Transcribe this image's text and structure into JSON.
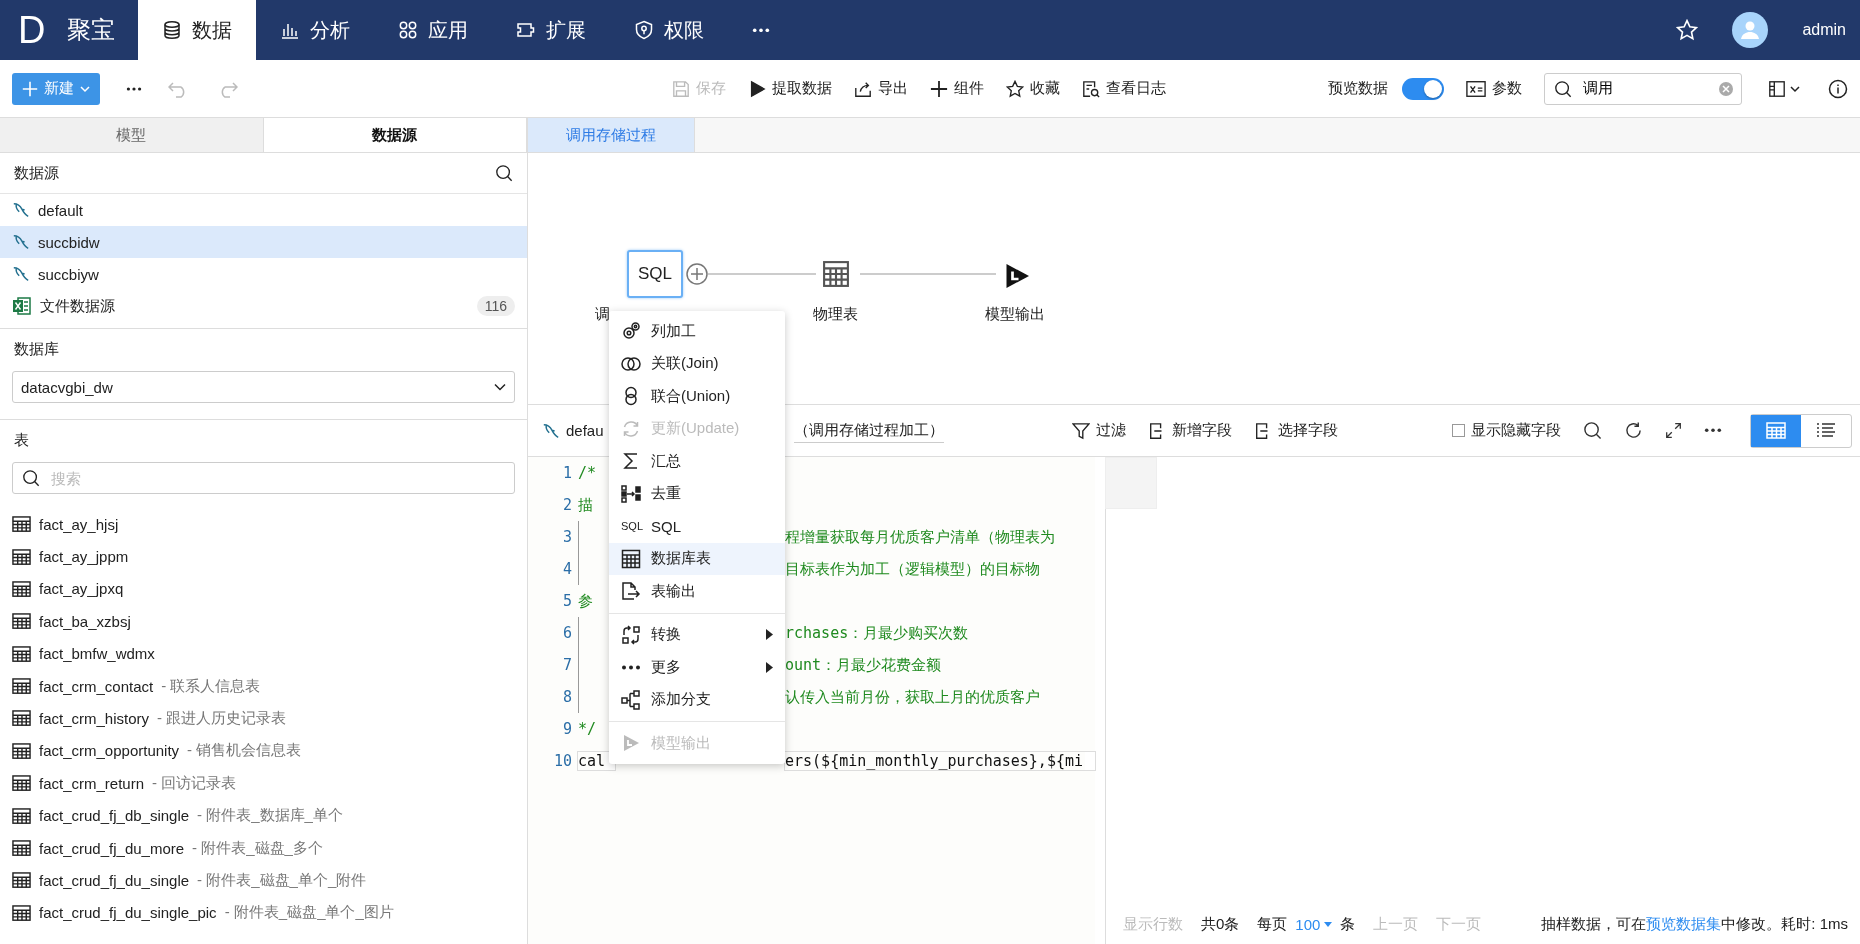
{
  "nav": {
    "logo_letter": "D",
    "brand": "聚宝",
    "tabs": [
      {
        "label": "数据",
        "selected": true
      },
      {
        "label": "分析",
        "selected": false
      },
      {
        "label": "应用",
        "selected": false
      },
      {
        "label": "扩展",
        "selected": false
      },
      {
        "label": "权限",
        "selected": false
      }
    ],
    "user": "admin"
  },
  "toolbar": {
    "new_button": "新建",
    "actions": [
      {
        "label": "保存",
        "disabled": true
      },
      {
        "label": "提取数据",
        "disabled": false
      },
      {
        "label": "导出",
        "disabled": false
      },
      {
        "label": "组件",
        "disabled": false
      },
      {
        "label": "收藏",
        "disabled": false
      },
      {
        "label": "查看日志",
        "disabled": false
      }
    ],
    "preview": {
      "label": "预览数据",
      "on": true
    },
    "params": "参数",
    "search": {
      "value": "调用"
    }
  },
  "left_tabs": [
    {
      "label": "模型",
      "selected": false
    },
    {
      "label": "数据源",
      "selected": true
    }
  ],
  "datasources": {
    "title": "数据源",
    "items": [
      {
        "name": "default",
        "kind": "db",
        "selected": false
      },
      {
        "name": "succbidw",
        "kind": "db",
        "selected": true
      },
      {
        "name": "succbiyw",
        "kind": "db",
        "selected": false
      },
      {
        "name": "文件数据源",
        "kind": "file",
        "count": "116",
        "selected": false
      }
    ]
  },
  "database": {
    "title": "数据库",
    "value": "datacvgbi_dw"
  },
  "tables": {
    "title": "表",
    "search_placeholder": "搜索",
    "items": [
      {
        "name": "fact_ay_hjsj"
      },
      {
        "name": "fact_ay_jppm"
      },
      {
        "name": "fact_ay_jpxq"
      },
      {
        "name": "fact_ba_xzbsj"
      },
      {
        "name": "fact_bmfw_wdmx"
      },
      {
        "name": "fact_crm_contact",
        "comment": "- 联系人信息表"
      },
      {
        "name": "fact_crm_history",
        "comment": "- 跟进人历史记录表"
      },
      {
        "name": "fact_crm_opportunity",
        "comment": "- 销售机会信息表"
      },
      {
        "name": "fact_crm_return",
        "comment": "- 回访记录表"
      },
      {
        "name": "fact_crud_fj_db_single",
        "comment": "- 附件表_数据库_单个"
      },
      {
        "name": "fact_crud_fj_du_more",
        "comment": "- 附件表_磁盘_多个"
      },
      {
        "name": "fact_crud_fj_du_single",
        "comment": "- 附件表_磁盘_单个_附件"
      },
      {
        "name": "fact_crud_fj_du_single_pic",
        "comment": "- 附件表_磁盘_单个_图片"
      }
    ]
  },
  "editor_tabs": [
    {
      "label": "调用存储过程",
      "selected": true
    }
  ],
  "flow": {
    "nodes": [
      {
        "kind": "sql",
        "text": "SQL",
        "label": "调",
        "selected": true
      },
      {
        "kind": "table",
        "label": "物理表",
        "selected": false
      },
      {
        "kind": "output",
        "label": "模型输出",
        "selected": false
      }
    ]
  },
  "editor_bar": {
    "source": "defau",
    "node_title": "（调用存储过程加工）",
    "actions": [
      "过滤",
      "新增字段",
      "选择字段"
    ],
    "show_hidden": {
      "label": "显示隐藏字段",
      "checked": false
    },
    "views": [
      {
        "kind": "grid",
        "selected": true
      },
      {
        "kind": "list",
        "selected": false
      }
    ]
  },
  "code": [
    {
      "number": "1",
      "kind": "comment",
      "guide": false,
      "left": "/*"
    },
    {
      "number": "2",
      "kind": "comment",
      "guide": false,
      "left": "描"
    },
    {
      "number": "3",
      "kind": "comment",
      "guide": true,
      "right": "程增量获取每月优质客户清单（物理表为"
    },
    {
      "number": "4",
      "kind": "comment",
      "guide": true,
      "right": "目标表作为加工（逻辑模型）的目标物"
    },
    {
      "number": "5",
      "kind": "comment",
      "guide": false,
      "left": "参"
    },
    {
      "number": "6",
      "kind": "comment",
      "guide": true,
      "right": "rchases：月最少购买次数"
    },
    {
      "number": "7",
      "kind": "comment",
      "guide": true,
      "right": "ount：月最少花费金额"
    },
    {
      "number": "8",
      "kind": "comment",
      "guide": true,
      "right": "认传入当前月份，获取上月的优质客户"
    },
    {
      "number": "9",
      "kind": "comment",
      "guide": false,
      "left": "*/"
    },
    {
      "number": "10",
      "kind": "code",
      "guide": false,
      "left": "cal",
      "right": "ers(${min_monthly_purchases},${mi"
    }
  ],
  "footer": {
    "rows_label": "显示行数",
    "total": "共0条",
    "per_page": "每页",
    "page_size": "100",
    "unit": "条",
    "prev": "上一页",
    "next": "下一页",
    "note_before": "抽样数据，可在",
    "note_link": "预览数据集",
    "note_after": "中修改。耗时: 1ms"
  },
  "menu": [
    {
      "kind": "item",
      "label": "列加工",
      "disabled": false,
      "highlighted": false,
      "submenu": false
    },
    {
      "kind": "item",
      "label": "关联(Join)",
      "disabled": false,
      "highlighted": false,
      "submenu": false
    },
    {
      "kind": "item",
      "label": "联合(Union)",
      "disabled": false,
      "highlighted": false,
      "submenu": false
    },
    {
      "kind": "item",
      "label": "更新(Update)",
      "disabled": true,
      "highlighted": false,
      "submenu": false
    },
    {
      "kind": "item",
      "label": "汇总",
      "disabled": false,
      "highlighted": false,
      "submenu": false
    },
    {
      "kind": "item",
      "label": "去重",
      "disabled": false,
      "highlighted": false,
      "submenu": false
    },
    {
      "kind": "item",
      "label": "SQL",
      "icon_text": "SQL",
      "disabled": false,
      "highlighted": false,
      "submenu": false
    },
    {
      "kind": "item",
      "label": "数据库表",
      "disabled": false,
      "highlighted": true,
      "submenu": false
    },
    {
      "kind": "item",
      "label": "表输出",
      "disabled": false,
      "highlighted": false,
      "submenu": false
    },
    {
      "kind": "divider"
    },
    {
      "kind": "item",
      "label": "转换",
      "disabled": false,
      "highlighted": false,
      "submenu": true
    },
    {
      "kind": "item",
      "label": "更多",
      "disabled": false,
      "highlighted": false,
      "submenu": true
    },
    {
      "kind": "item",
      "label": "添加分支",
      "disabled": false,
      "highlighted": false,
      "submenu": false
    },
    {
      "kind": "divider"
    },
    {
      "kind": "item",
      "label": "模型输出",
      "disabled": true,
      "highlighted": false,
      "submenu": false
    }
  ]
}
